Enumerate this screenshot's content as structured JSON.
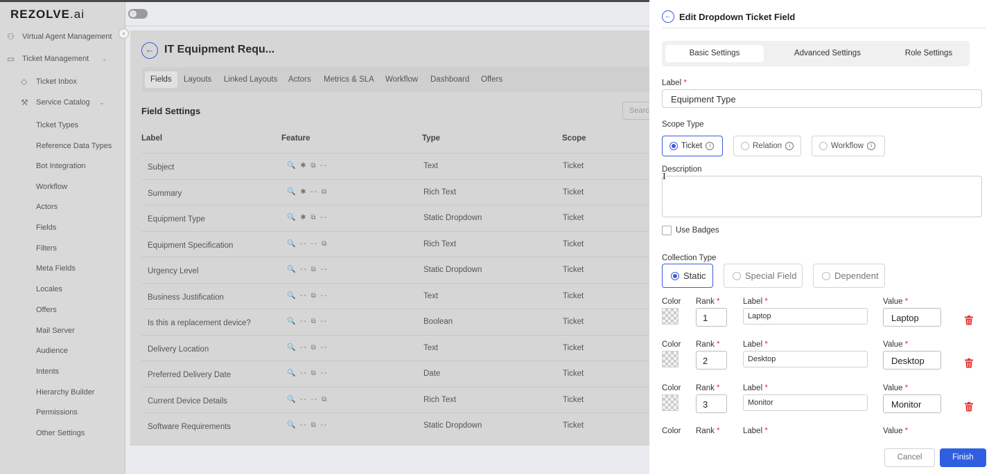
{
  "app": {
    "logo": "REZOLVE",
    "logo_suffix": ".ai"
  },
  "sidebar": {
    "top_items": [
      {
        "label": "Virtual Agent Management",
        "icon": "agents-icon"
      },
      {
        "label": "Ticket Management",
        "icon": "ticket-mgmt-icon"
      }
    ],
    "ticket_inbox": "Ticket Inbox",
    "service_catalog": "Service Catalog",
    "sub_items": [
      "Ticket Types",
      "Reference Data Types",
      "Bot Integration",
      "Workflow",
      "Actors",
      "Fields",
      "Filters",
      "Meta Fields",
      "Locales",
      "Offers",
      "Mail Server",
      "Audience",
      "Intents",
      "Hierarchy Builder",
      "Permissions",
      "Other Settings"
    ]
  },
  "page": {
    "title": "IT Equipment Requ...",
    "tabs": [
      "Fields",
      "Layouts",
      "Linked Layouts",
      "Actors",
      "Metrics & SLA",
      "Workflow",
      "Dashboard",
      "Offers"
    ],
    "section_title": "Field Settings",
    "search_placeholder": "Search",
    "columns": [
      "Label",
      "Feature",
      "Type",
      "Scope"
    ],
    "rows": [
      {
        "label": "Subject",
        "feature": "🔍 ✱ ⧉ --",
        "type": "Text",
        "scope": "Ticket"
      },
      {
        "label": "Summary",
        "feature": "🔍 ✱ -- ⧉",
        "type": "Rich Text",
        "scope": "Ticket"
      },
      {
        "label": "Equipment Type",
        "feature": "🔍 ✱ ⧉ --",
        "type": "Static Dropdown",
        "scope": "Ticket"
      },
      {
        "label": "Equipment Specification",
        "feature": "🔍 -- -- ⧉",
        "type": "Rich Text",
        "scope": "Ticket"
      },
      {
        "label": "Urgency Level",
        "feature": "🔍 -- ⧉ --",
        "type": "Static Dropdown",
        "scope": "Ticket"
      },
      {
        "label": "Business Justification",
        "feature": "🔍 -- ⧉ --",
        "type": "Text",
        "scope": "Ticket"
      },
      {
        "label": "Is this a replacement device?",
        "feature": "🔍 -- ⧉ --",
        "type": "Boolean",
        "scope": "Ticket"
      },
      {
        "label": "Delivery Location",
        "feature": "🔍 -- ⧉ --",
        "type": "Text",
        "scope": "Ticket"
      },
      {
        "label": "Preferred Delivery Date",
        "feature": "🔍 -- ⧉ --",
        "type": "Date",
        "scope": "Ticket"
      },
      {
        "label": "Current Device Details",
        "feature": "🔍 -- -- ⧉",
        "type": "Rich Text",
        "scope": "Ticket"
      },
      {
        "label": "Software Requirements",
        "feature": "🔍 -- ⧉ --",
        "type": "Static Dropdown",
        "scope": "Ticket"
      }
    ]
  },
  "drawer": {
    "title": "Edit Dropdown Ticket Field",
    "tabs": [
      {
        "label": "Basic Settings",
        "active": true
      },
      {
        "label": "Advanced Settings",
        "active": false
      },
      {
        "label": "Role Settings",
        "active": false
      }
    ],
    "label_label": "Label",
    "label_value": "Equipment Type",
    "scope_type_label": "Scope Type",
    "scope_options": [
      {
        "label": "Ticket",
        "selected": true
      },
      {
        "label": "Relation",
        "selected": false
      },
      {
        "label": "Workflow",
        "selected": false
      }
    ],
    "description_label": "Description",
    "use_badges_label": "Use Badges",
    "collection_type_label": "Collection Type",
    "collection_options": [
      {
        "label": "Static",
        "selected": true
      },
      {
        "label": "Special Field",
        "selected": false
      },
      {
        "label": "Dependent",
        "selected": false
      }
    ],
    "option_headers": {
      "color": "Color",
      "rank": "Rank",
      "label": "Label",
      "value": "Value"
    },
    "options": [
      {
        "rank": "1",
        "label": "Laptop",
        "value": "Laptop"
      },
      {
        "rank": "2",
        "label": "Desktop",
        "value": "Desktop"
      },
      {
        "rank": "3",
        "label": "Monitor",
        "value": "Monitor"
      }
    ],
    "cancel_label": "Cancel",
    "finish_label": "Finish"
  },
  "colors": {
    "accent": "#2f5fe0",
    "danger": "#e03131"
  }
}
